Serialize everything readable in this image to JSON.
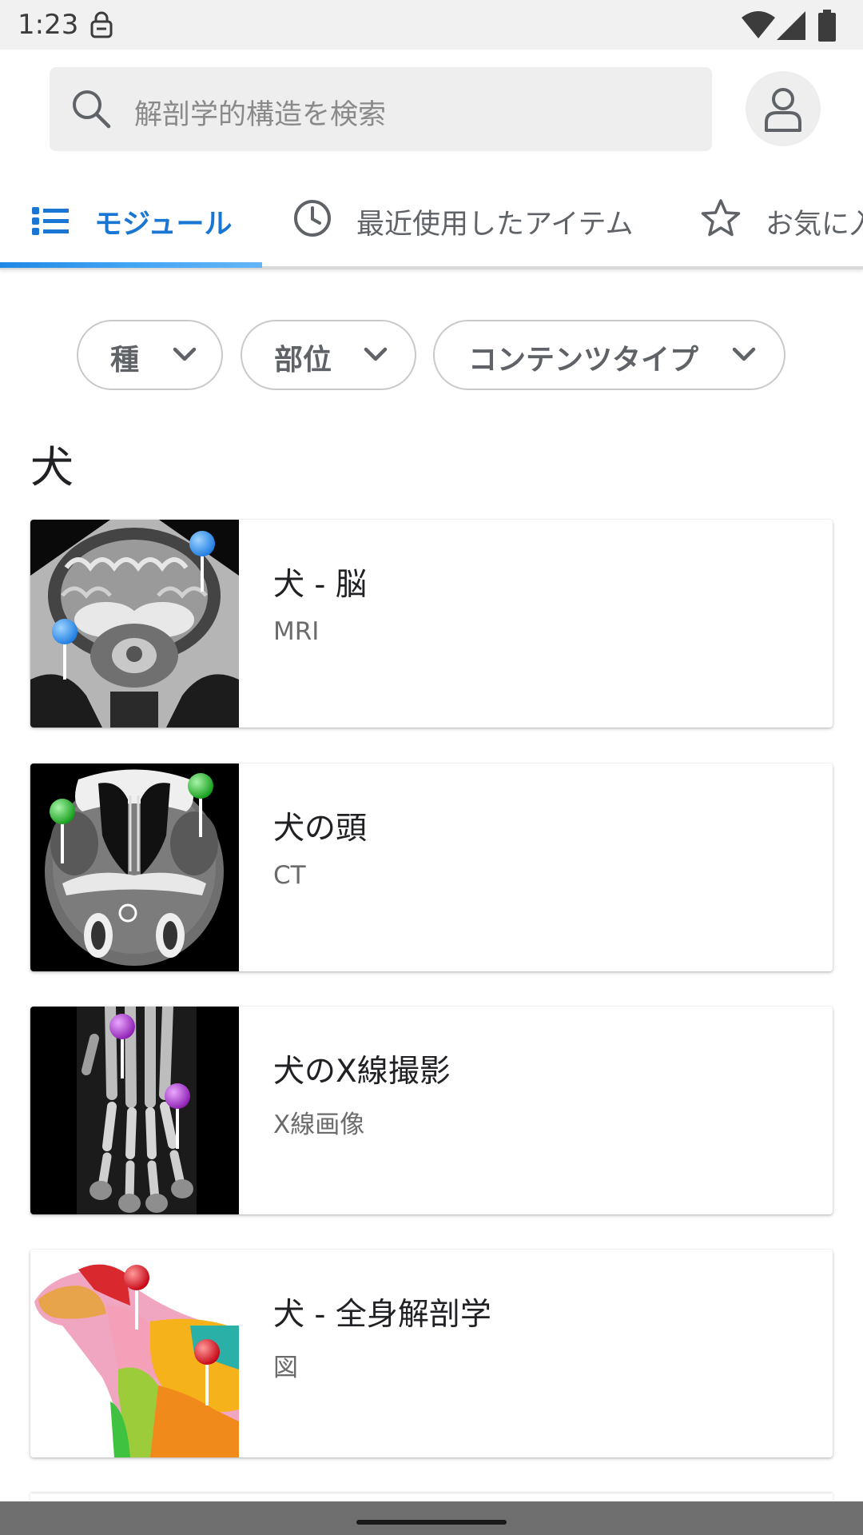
{
  "status_bar": {
    "time": "1:23"
  },
  "search": {
    "placeholder": "解剖学的構造を検索"
  },
  "tabs": [
    {
      "label": "モジュール",
      "icon": "list-icon",
      "active": true
    },
    {
      "label": "最近使用したアイテム",
      "icon": "clock-icon",
      "active": false
    },
    {
      "label": "お気に入",
      "icon": "star-icon",
      "active": false
    }
  ],
  "filters": [
    {
      "label": "種"
    },
    {
      "label": "部位"
    },
    {
      "label": "コンテンツタイプ"
    }
  ],
  "section": {
    "title": "犬"
  },
  "modules": [
    {
      "title": "犬 - 脳",
      "subtitle": "MRI",
      "pin_color": "#2e8ef0"
    },
    {
      "title": "犬の頭",
      "subtitle": "CT",
      "pin_color": "#22c32a"
    },
    {
      "title": "犬のX線撮影",
      "subtitle": "X線画像",
      "pin_color": "#b42fd8"
    },
    {
      "title": "犬 - 全身解剖学",
      "subtitle": "図",
      "pin_color": "#e0141e"
    }
  ],
  "colors": {
    "accent": "#1976d2"
  }
}
